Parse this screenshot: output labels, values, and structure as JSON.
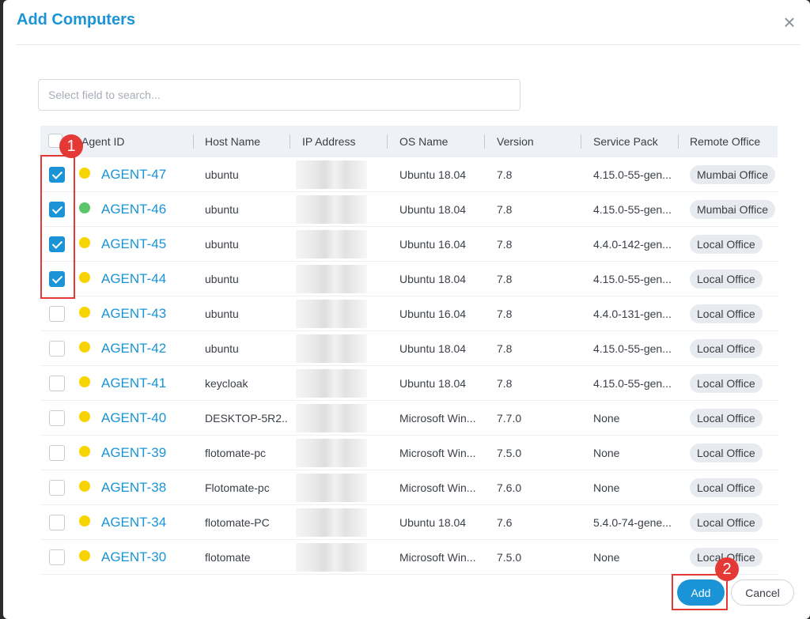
{
  "dialog": {
    "title": "Add Computers",
    "close_icon": "close-icon"
  },
  "search": {
    "placeholder": "Select field to search..."
  },
  "table": {
    "headers": {
      "agent_id": "Agent ID",
      "host_name": "Host Name",
      "ip_address": "IP Address",
      "os_name": "OS Name",
      "version": "Version",
      "service_pack": "Service Pack",
      "remote_office": "Remote Office"
    },
    "rows": [
      {
        "checked": true,
        "status": "yellow",
        "agent": "AGENT-47",
        "host": "ubuntu",
        "os": "Ubuntu 18.04",
        "version": "7.8",
        "service_pack": "4.15.0-55-gen...",
        "office": "Mumbai Office"
      },
      {
        "checked": true,
        "status": "green",
        "agent": "AGENT-46",
        "host": "ubuntu",
        "os": "Ubuntu 18.04",
        "version": "7.8",
        "service_pack": "4.15.0-55-gen...",
        "office": "Mumbai Office"
      },
      {
        "checked": true,
        "status": "yellow",
        "agent": "AGENT-45",
        "host": "ubuntu",
        "os": "Ubuntu 16.04",
        "version": "7.8",
        "service_pack": "4.4.0-142-gen...",
        "office": "Local Office"
      },
      {
        "checked": true,
        "status": "yellow",
        "agent": "AGENT-44",
        "host": "ubuntu",
        "os": "Ubuntu 18.04",
        "version": "7.8",
        "service_pack": "4.15.0-55-gen...",
        "office": "Local Office"
      },
      {
        "checked": false,
        "status": "yellow",
        "agent": "AGENT-43",
        "host": "ubuntu",
        "os": "Ubuntu 16.04",
        "version": "7.8",
        "service_pack": "4.4.0-131-gen...",
        "office": "Local Office"
      },
      {
        "checked": false,
        "status": "yellow",
        "agent": "AGENT-42",
        "host": "ubuntu",
        "os": "Ubuntu 18.04",
        "version": "7.8",
        "service_pack": "4.15.0-55-gen...",
        "office": "Local Office"
      },
      {
        "checked": false,
        "status": "yellow",
        "agent": "AGENT-41",
        "host": "keycloak",
        "os": "Ubuntu 18.04",
        "version": "7.8",
        "service_pack": "4.15.0-55-gen...",
        "office": "Local Office"
      },
      {
        "checked": false,
        "status": "yellow",
        "agent": "AGENT-40",
        "host": "DESKTOP-5R2...",
        "os": "Microsoft Win...",
        "version": "7.7.0",
        "service_pack": "None",
        "office": "Local Office"
      },
      {
        "checked": false,
        "status": "yellow",
        "agent": "AGENT-39",
        "host": "flotomate-pc",
        "os": "Microsoft Win...",
        "version": "7.5.0",
        "service_pack": "None",
        "office": "Local Office"
      },
      {
        "checked": false,
        "status": "yellow",
        "agent": "AGENT-38",
        "host": "Flotomate-pc",
        "os": "Microsoft Win...",
        "version": "7.6.0",
        "service_pack": "None",
        "office": "Local Office"
      },
      {
        "checked": false,
        "status": "yellow",
        "agent": "AGENT-34",
        "host": "flotomate-PC",
        "os": "Ubuntu 18.04",
        "version": "7.6",
        "service_pack": "5.4.0-74-gene...",
        "office": "Local Office"
      },
      {
        "checked": false,
        "status": "yellow",
        "agent": "AGENT-30",
        "host": "flotomate",
        "os": "Microsoft Win...",
        "version": "7.5.0",
        "service_pack": "None",
        "office": "Local Office"
      }
    ]
  },
  "footer": {
    "add_label": "Add",
    "cancel_label": "Cancel"
  },
  "annotations": {
    "badge_1": "1",
    "badge_2": "2"
  },
  "colors": {
    "accent": "#1a94d6",
    "status_yellow": "#f7d400",
    "status_green": "#5cc46b",
    "annotation_red": "#e53935"
  }
}
